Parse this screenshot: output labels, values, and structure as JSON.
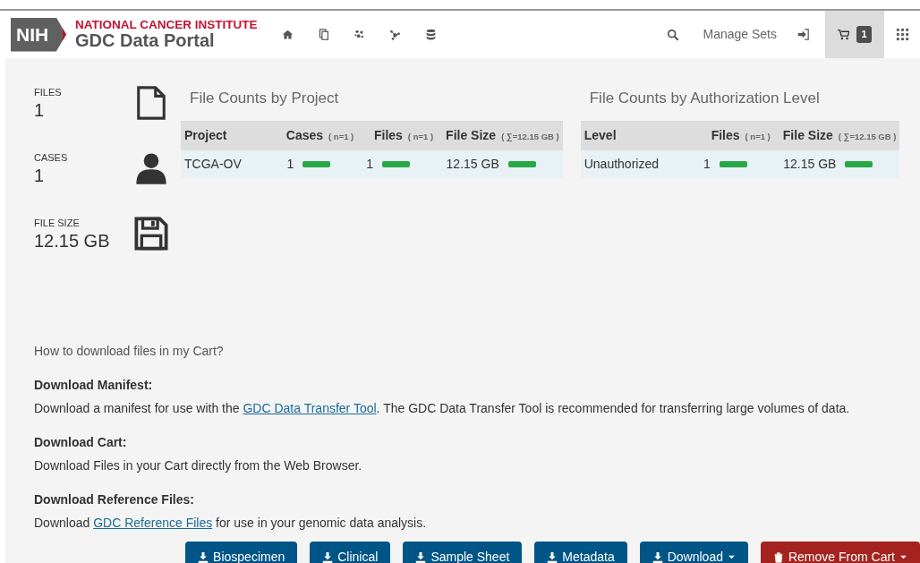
{
  "header": {
    "logo_mark": "NIH",
    "institute": "NATIONAL CANCER INSTITUTE",
    "portal": "GDC Data Portal",
    "manage_sets": "Manage Sets",
    "cart_count": "1",
    "cart_selected": true
  },
  "summary": [
    {
      "kind": "file",
      "label": "FILES",
      "value": "1"
    },
    {
      "kind": "person",
      "label": "CASES",
      "value": "1"
    },
    {
      "kind": "disk",
      "label": "FILE SIZE",
      "value": "12.15 GB"
    }
  ],
  "tables": [
    {
      "title": "File Counts by Project",
      "columns": [
        {
          "label": "Project"
        },
        {
          "label": "Cases",
          "note": "( n=1 )"
        },
        {
          "label": "Files",
          "note": "( n=1 )"
        },
        {
          "label": "File Size",
          "note": "( ∑=12.15 GB )"
        }
      ],
      "rows": [
        {
          "cells": [
            {
              "text": "TCGA-OV"
            },
            {
              "text": "1",
              "bar": true
            },
            {
              "text": "1",
              "bar": true
            },
            {
              "text": "12.15 GB",
              "bar": true
            }
          ]
        }
      ]
    },
    {
      "title": "File Counts by Authorization Level",
      "columns": [
        {
          "label": "Level"
        },
        {
          "label": "Files",
          "note": "( n=1 )"
        },
        {
          "label": "File Size",
          "note": "( ∑=12.15 GB )"
        }
      ],
      "rows": [
        {
          "cells": [
            {
              "text": "Unauthorized"
            },
            {
              "text": "1",
              "bar": true
            },
            {
              "text": "12.15 GB",
              "bar": true
            }
          ]
        }
      ]
    }
  ],
  "help_link": "How to download files in my Cart?",
  "sections": [
    {
      "heading": "Download Manifest:",
      "before": "Download a manifest for use with the ",
      "link": "GDC Data Transfer Tool",
      "after": ". The GDC Data Transfer Tool is recommended for transferring large volumes of data."
    },
    {
      "heading": "Download Cart:",
      "before": "Download Files in your Cart directly from the Web Browser."
    },
    {
      "heading": "Download Reference Files:",
      "before": "Download ",
      "link": "GDC Reference Files",
      "after": " for use in your genomic data analysis."
    }
  ],
  "buttons": [
    {
      "label": "Biospecimen",
      "kind": "download",
      "dropdown": false
    },
    {
      "label": "Clinical",
      "kind": "download",
      "dropdown": false
    },
    {
      "label": "Sample Sheet",
      "kind": "download",
      "dropdown": false
    },
    {
      "label": "Metadata",
      "kind": "download",
      "dropdown": false
    },
    {
      "label": "Download",
      "kind": "download",
      "dropdown": true
    },
    {
      "label": "Remove From Cart",
      "kind": "remove",
      "dropdown": true
    }
  ]
}
